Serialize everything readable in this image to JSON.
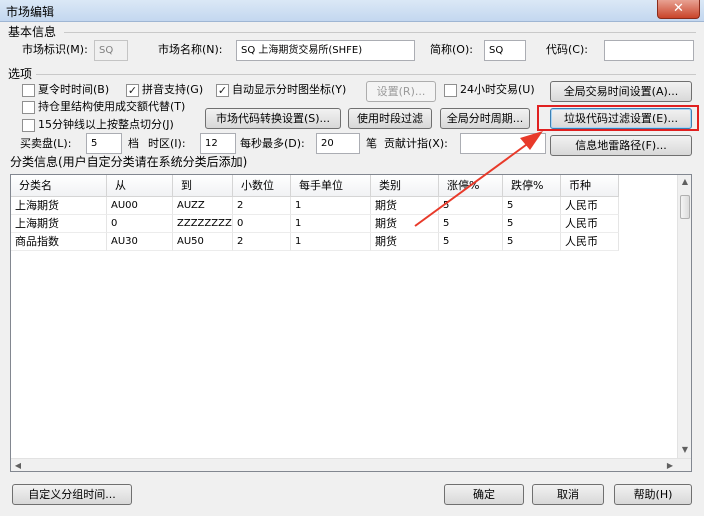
{
  "window": {
    "title": "市场编辑",
    "close": "✕"
  },
  "basic": {
    "section_title": "基本信息",
    "market_id_label": "市场标识(M):",
    "market_id_value": "SQ",
    "market_name_label": "市场名称(N):",
    "market_name_value": "SQ 上海期货交易所(SHFE)",
    "abbr_label": "简称(O):",
    "abbr_value": "SQ",
    "code_label": "代码(C):",
    "code_value": ""
  },
  "options": {
    "section_title": "选项",
    "dst": {
      "label": "夏令时时间(B)",
      "checked": false
    },
    "pinyin": {
      "label": "拼音支持(G)",
      "checked": true
    },
    "auto_time_axis": {
      "label": "自动显示分时图坐标(Y)",
      "checked": true
    },
    "settings_button": "设置(R)...",
    "trading_24h": {
      "label": "24小时交易(U)",
      "checked": false
    },
    "global_time_button": "全局交易时间设置(A)...",
    "position_structure": {
      "label": "持仓里结构使用成交额代替(T)",
      "checked": false
    },
    "code_convert_button": "市场代码转换设置(S)...",
    "time_filter_button": "使用时段过滤",
    "global_period_button": "全局分时周期...",
    "junk_code_button": "垃圾代码过滤设置(E)...",
    "fifteen_min": {
      "label": "15分钟线以上按整点切分(J)",
      "checked": false
    },
    "info_mine_button": "信息地雷路径(F)...",
    "bidask_label": "买卖盘(L):",
    "bidask_value": "5",
    "bidask_unit": "档",
    "timezone_label": "时区(I):",
    "timezone_value": "12",
    "maxper_label": "每秒最多(D):",
    "maxper_value": "20",
    "maxper_unit": "笔",
    "contrib_label": "贡献计指(X):",
    "contrib_value": ""
  },
  "category": {
    "section_title": "分类信息(用户自定分类请在系统分类后添加)",
    "columns": [
      "分类名",
      "从",
      "到",
      "小数位",
      "每手单位",
      "类别",
      "涨停%",
      "跌停%",
      "币种"
    ],
    "rows": [
      [
        "上海期货",
        "AU00",
        "AUZZ",
        "2",
        "1",
        "期货",
        "5",
        "5",
        "人民币"
      ],
      [
        "上海期货",
        "0",
        "ZZZZZZZZ",
        "0",
        "1",
        "期货",
        "5",
        "5",
        "人民币"
      ],
      [
        "商品指数",
        "AU30",
        "AU50",
        "2",
        "1",
        "期货",
        "5",
        "5",
        "人民币"
      ]
    ]
  },
  "footer": {
    "custom_group_button": "自定义分组时间...",
    "ok_button": "确定",
    "cancel_button": "取消",
    "help_button": "帮助(H)"
  },
  "colors": {
    "highlight": "#e02020",
    "arrow": "#e83a2a"
  }
}
